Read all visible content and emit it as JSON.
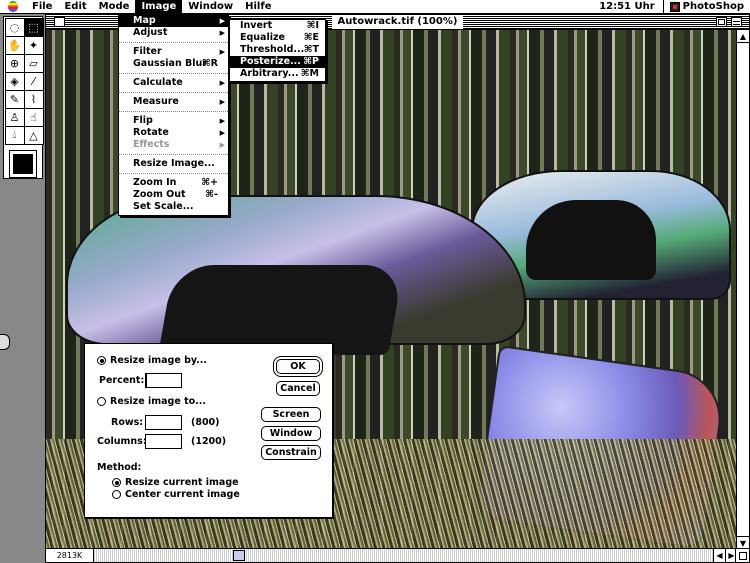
{
  "menubar": {
    "items": [
      "File",
      "Edit",
      "Mode",
      "Image",
      "Window",
      "Hilfe"
    ],
    "active_index": 3,
    "clock": "12:51 Uhr",
    "app_name": "PhotoShop"
  },
  "window": {
    "title": "Autowrack.tif (100%)",
    "size_field": "2813K"
  },
  "image_menu": {
    "items": [
      {
        "label": "Map",
        "shortcut": "",
        "submenu": true,
        "state": "highlighted"
      },
      {
        "label": "Adjust",
        "shortcut": "",
        "submenu": true,
        "state": "normal"
      },
      {
        "label": "Filter",
        "shortcut": "",
        "submenu": true,
        "state": "normal"
      },
      {
        "label": "Gaussian Blur",
        "shortcut": "⌘R",
        "submenu": false,
        "state": "normal"
      },
      {
        "label": "Calculate",
        "shortcut": "",
        "submenu": true,
        "state": "normal"
      },
      {
        "label": "Measure",
        "shortcut": "",
        "submenu": true,
        "state": "normal"
      },
      {
        "label": "Flip",
        "shortcut": "",
        "submenu": true,
        "state": "normal"
      },
      {
        "label": "Rotate",
        "shortcut": "",
        "submenu": true,
        "state": "normal"
      },
      {
        "label": "Effects",
        "shortcut": "",
        "submenu": true,
        "state": "disabled"
      },
      {
        "label": "Resize Image...",
        "shortcut": "",
        "submenu": false,
        "state": "normal"
      },
      {
        "label": "Zoom In",
        "shortcut": "⌘+",
        "submenu": false,
        "state": "normal"
      },
      {
        "label": "Zoom Out",
        "shortcut": "⌘-",
        "submenu": false,
        "state": "normal"
      },
      {
        "label": "Set Scale...",
        "shortcut": "",
        "submenu": false,
        "state": "normal"
      }
    ]
  },
  "map_menu": {
    "items": [
      {
        "label": "Invert",
        "shortcut": "⌘I",
        "state": "normal"
      },
      {
        "label": "Equalize",
        "shortcut": "⌘E",
        "state": "normal"
      },
      {
        "label": "Threshold...",
        "shortcut": "⌘T",
        "state": "normal"
      },
      {
        "label": "Posterize...",
        "shortcut": "⌘P",
        "state": "highlighted"
      },
      {
        "label": "Arbitrary...",
        "shortcut": "⌘M",
        "state": "normal"
      }
    ]
  },
  "dialog": {
    "resize_by_label": "Resize image by...",
    "percent_label": "Percent:",
    "percent_value": "",
    "resize_to_label": "Resize image to...",
    "rows_label": "Rows:",
    "rows_value": "",
    "rows_hint": "(800)",
    "columns_label": "Columns:",
    "columns_value": "",
    "columns_hint": "(1200)",
    "method_label": "Method:",
    "method_resize": "Resize current image",
    "method_center": "Center current image",
    "buttons": {
      "ok": "OK",
      "cancel": "Cancel",
      "screen": "Screen",
      "window": "Window",
      "constrain": "Constrain"
    }
  },
  "tools": [
    "lasso-icon",
    "marquee-icon",
    "hand-icon",
    "magic-wand-icon",
    "crosshair-icon",
    "eraser-icon",
    "bucket-icon",
    "eyedropper-icon",
    "pencil-icon",
    "brush-icon",
    "stamp-icon",
    "smudge-icon",
    "drop-icon",
    "cone-icon"
  ]
}
